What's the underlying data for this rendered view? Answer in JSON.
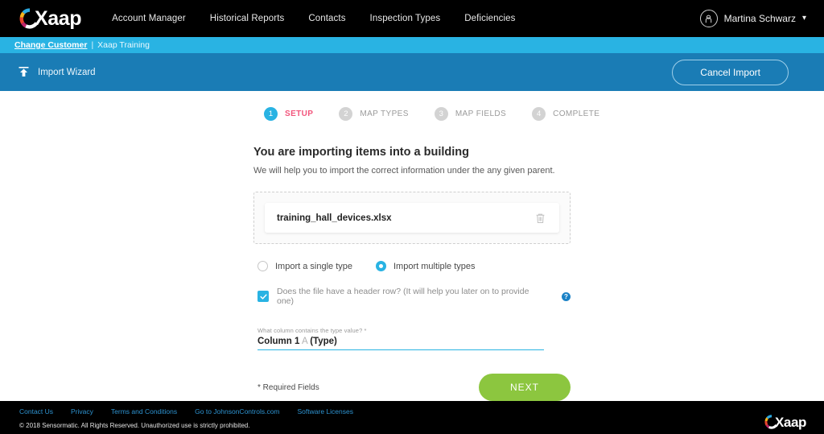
{
  "brand": {
    "name": "Xaap",
    "logo_colors": [
      "#2ba9e0",
      "#f5b21b",
      "#e8452c",
      "#c0256b"
    ]
  },
  "topnav": {
    "items": [
      {
        "label": "Account Manager"
      },
      {
        "label": "Historical Reports"
      },
      {
        "label": "Contacts"
      },
      {
        "label": "Inspection Types"
      },
      {
        "label": "Deficiencies"
      }
    ],
    "user": {
      "name": "Martina Schwarz",
      "avatar_icon": "user-avatar-icon",
      "chevron": "⌄"
    }
  },
  "customer_bar": {
    "change_link": "Change Customer",
    "separator": "|",
    "customer": "Xaap Training",
    "color": "#29b3e3"
  },
  "wizard_bar": {
    "icon": "import-upload-icon",
    "title": "Import Wizard",
    "cancel_label": "Cancel Import",
    "color": "#1a7cb5"
  },
  "stepper": {
    "active_color": "#29b3e3",
    "active_label_color": "#f2557c",
    "steps": [
      {
        "number": "1",
        "label": "SETUP",
        "active": true
      },
      {
        "number": "2",
        "label": "MAP TYPES",
        "active": false
      },
      {
        "number": "3",
        "label": "MAP FIELDS",
        "active": false
      },
      {
        "number": "4",
        "label": "COMPLETE",
        "active": false
      }
    ]
  },
  "form": {
    "title": "You are importing items into a building",
    "subtitle": "We will help you to import the correct information under the any given parent.",
    "file": {
      "name": "training_hall_devices.xlsx",
      "delete_icon": "trash-icon"
    },
    "type_mode": {
      "options": [
        {
          "label": "Import a single type",
          "selected": false
        },
        {
          "label": "Import multiple types",
          "selected": true
        }
      ]
    },
    "header_row": {
      "label": "Does the file have a header row? (It will help you later on to provide one)",
      "checked": true,
      "help_icon": "?"
    },
    "column_field": {
      "label": "What column contains the type value? *",
      "value_main": "Column 1",
      "value_dim": "A",
      "value_tail": "(Type)"
    },
    "required_note": "* Required Fields",
    "next_label": "NEXT",
    "next_color": "#8cc63f"
  },
  "footer": {
    "links": [
      {
        "label": "Contact Us"
      },
      {
        "label": "Privacy"
      },
      {
        "label": "Terms and Conditions"
      },
      {
        "label": "Go to JohnsonControls.com"
      },
      {
        "label": "Software Licenses"
      }
    ],
    "copyright": "© 2018 Sensormatic. All Rights Reserved. Unauthorized use is strictly prohibited."
  }
}
